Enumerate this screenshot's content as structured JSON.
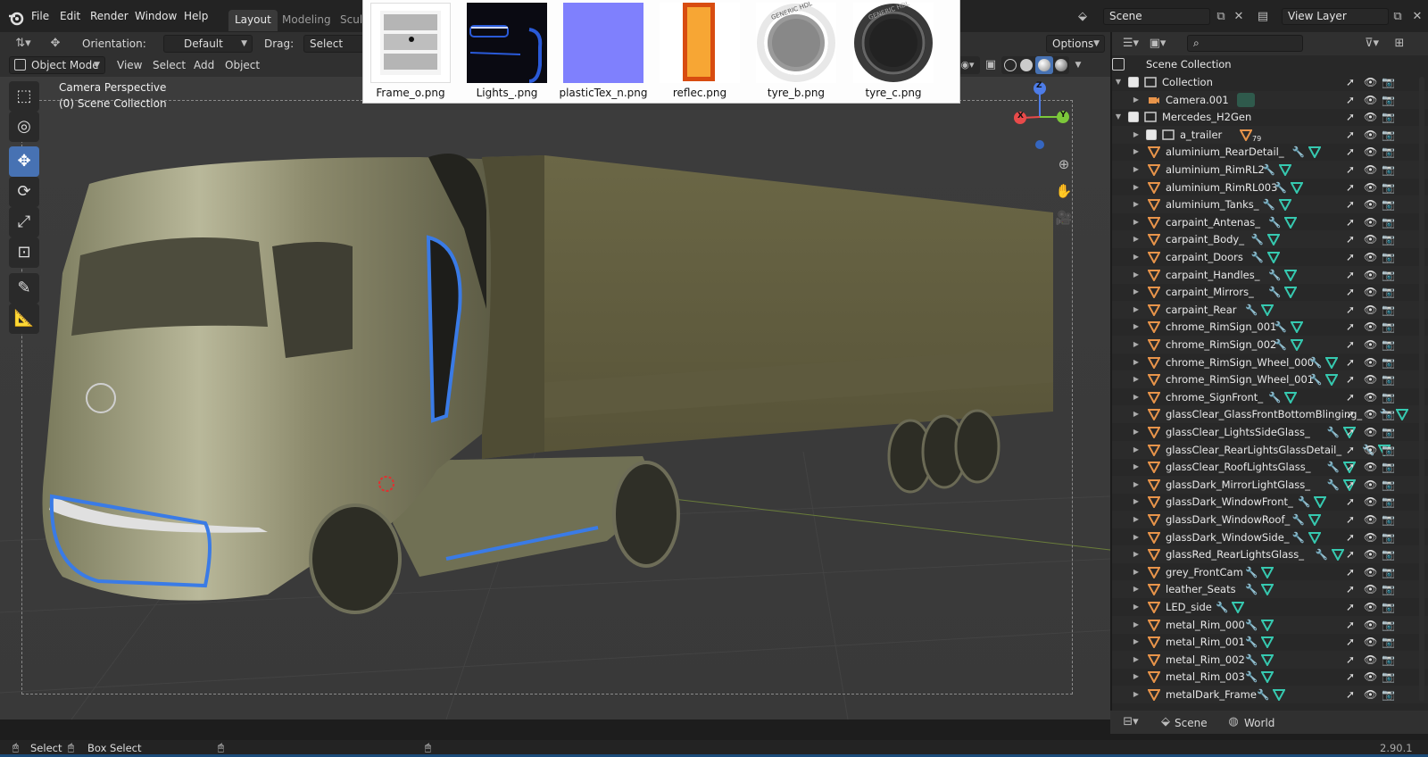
{
  "topbar": {
    "menus": [
      "File",
      "Edit",
      "Render",
      "Window",
      "Help"
    ],
    "workspaces": [
      "Layout",
      "Modeling",
      "Sculp"
    ],
    "active_workspace": "Layout",
    "scene_field": "Scene",
    "view_layer_field": "View Layer"
  },
  "header": {
    "orientation_label": "Orientation:",
    "orientation_value": "Default",
    "drag_label": "Drag:",
    "drag_value": "Select Box",
    "options_label": "Options",
    "mode_value": "Object Mode",
    "menus": [
      "View",
      "Select",
      "Add",
      "Object"
    ]
  },
  "viewport": {
    "camera_text": "Camera Perspective",
    "collection_text": "(0) Scene Collection",
    "gizmo_x": "X",
    "gizmo_y": "Y",
    "gizmo_z": "Z"
  },
  "textures": [
    {
      "label": "Frame_o.png",
      "icon": "dotted-pattern-thumbnail"
    },
    {
      "label": "Lights_.png",
      "icon": "lights-thumbnail"
    },
    {
      "label": "plasticTex_n.png",
      "icon": "normal-map-thumbnail"
    },
    {
      "label": "reflec.png",
      "icon": "reflection-thumbnail"
    },
    {
      "label": "tyre_b.png",
      "icon": "tyre-white-thumbnail"
    },
    {
      "label": "tyre_c.png",
      "icon": "tyre-dark-thumbnail"
    }
  ],
  "tyre_text": "GENERIC HDL",
  "outliner": {
    "root": "Scene Collection",
    "rows": [
      {
        "label": "Collection",
        "kind": "collection"
      },
      {
        "label": "Camera.001",
        "kind": "camera"
      },
      {
        "label": "Mercedes_H2Gen",
        "kind": "collection"
      },
      {
        "label": "a_trailer",
        "kind": "empty",
        "badge": "79"
      },
      {
        "label": "aluminium_RearDetail_",
        "kind": "mesh"
      },
      {
        "label": "aluminium_RimRL2",
        "kind": "mesh"
      },
      {
        "label": "aluminium_RimRL003",
        "kind": "mesh"
      },
      {
        "label": "aluminium_Tanks_",
        "kind": "mesh"
      },
      {
        "label": "carpaint_Antenas_",
        "kind": "mesh"
      },
      {
        "label": "carpaint_Body_",
        "kind": "mesh"
      },
      {
        "label": "carpaint_Doors",
        "kind": "mesh"
      },
      {
        "label": "carpaint_Handles_",
        "kind": "mesh"
      },
      {
        "label": "carpaint_Mirrors_",
        "kind": "mesh"
      },
      {
        "label": "carpaint_Rear",
        "kind": "mesh"
      },
      {
        "label": "chrome_RimSign_001",
        "kind": "mesh"
      },
      {
        "label": "chrome_RimSign_002",
        "kind": "mesh"
      },
      {
        "label": "chrome_RimSign_Wheel_000",
        "kind": "mesh"
      },
      {
        "label": "chrome_RimSign_Wheel_001",
        "kind": "mesh"
      },
      {
        "label": "chrome_SignFront_",
        "kind": "mesh"
      },
      {
        "label": "glassClear_GlassFrontBottomBlinging_",
        "kind": "mesh"
      },
      {
        "label": "glassClear_LightsSideGlass_",
        "kind": "mesh"
      },
      {
        "label": "glassClear_RearLightsGlassDetail_",
        "kind": "mesh"
      },
      {
        "label": "glassClear_RoofLightsGlass_",
        "kind": "mesh"
      },
      {
        "label": "glassDark_MirrorLightGlass_",
        "kind": "mesh"
      },
      {
        "label": "glassDark_WindowFront_",
        "kind": "mesh"
      },
      {
        "label": "glassDark_WindowRoof_",
        "kind": "mesh"
      },
      {
        "label": "glassDark_WindowSide_",
        "kind": "mesh"
      },
      {
        "label": "glassRed_RearLightsGlass_",
        "kind": "mesh"
      },
      {
        "label": "grey_FrontCam",
        "kind": "mesh"
      },
      {
        "label": "leather_Seats",
        "kind": "mesh"
      },
      {
        "label": "LED_side",
        "kind": "mesh"
      },
      {
        "label": "metal_Rim_000",
        "kind": "mesh"
      },
      {
        "label": "metal_Rim_001",
        "kind": "mesh"
      },
      {
        "label": "metal_Rim_002",
        "kind": "mesh"
      },
      {
        "label": "metal_Rim_003",
        "kind": "mesh"
      },
      {
        "label": "metalDark_Frame",
        "kind": "mesh"
      }
    ],
    "footer_scene": "Scene",
    "footer_world": "World"
  },
  "status": {
    "select": "Select",
    "box_select": "Box Select",
    "version": "2.90.1"
  },
  "colors": {
    "accent": "#4772b3",
    "mesh_icon": "#e8944a",
    "modifier_icon": "#6d9de6",
    "vertex_group_icon": "#36c9b0"
  }
}
